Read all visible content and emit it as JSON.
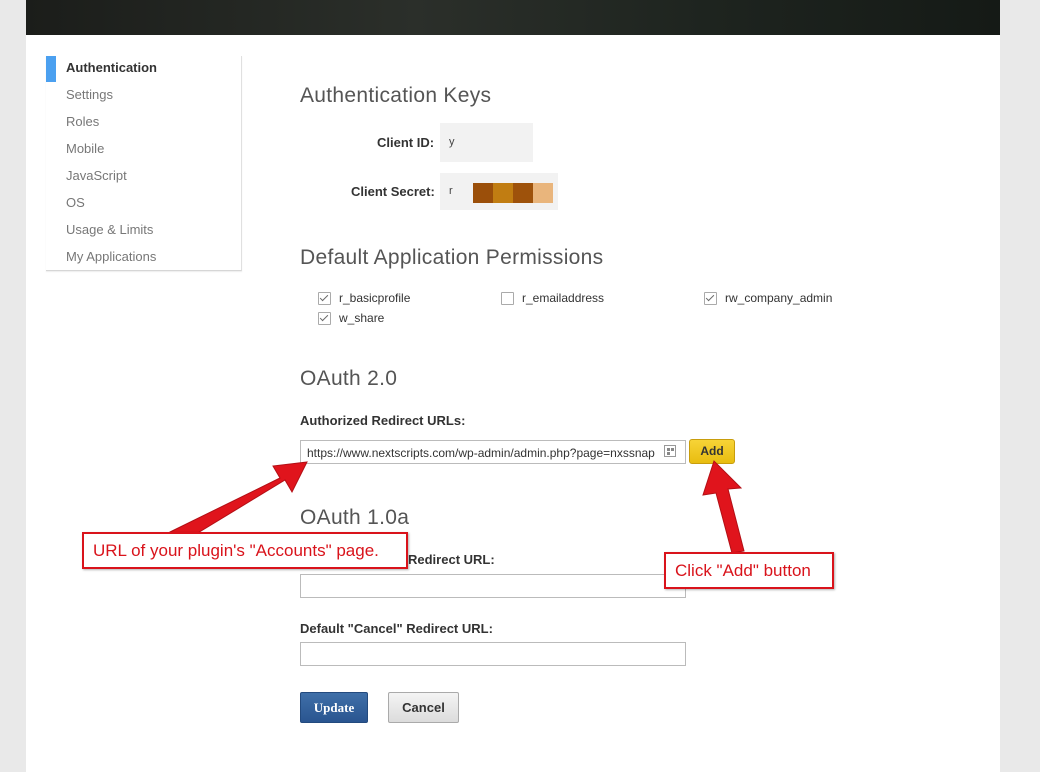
{
  "sidebar": {
    "items": [
      {
        "label": "Authentication",
        "active": true
      },
      {
        "label": "Settings"
      },
      {
        "label": "Roles"
      },
      {
        "label": "Mobile"
      },
      {
        "label": "JavaScript"
      },
      {
        "label": "OS"
      },
      {
        "label": "Usage & Limits"
      },
      {
        "label": "My Applications"
      }
    ]
  },
  "auth_keys": {
    "title": "Authentication Keys",
    "client_id_label": "Client ID:",
    "client_id_value": "y",
    "client_secret_label": "Client Secret:",
    "client_secret_value": "r"
  },
  "permissions": {
    "title": "Default Application Permissions",
    "items": [
      {
        "label": "r_basicprofile",
        "checked": true
      },
      {
        "label": "r_emailaddress",
        "checked": false
      },
      {
        "label": "rw_company_admin",
        "checked": true
      },
      {
        "label": "w_share",
        "checked": true
      }
    ]
  },
  "oauth2": {
    "title": "OAuth 2.0",
    "redirect_label": "Authorized Redirect URLs:",
    "redirect_value": "https://www.nextscripts.com/wp-admin/admin.php?page=nxssnap",
    "add_label": "Add"
  },
  "oauth1": {
    "title": "OAuth 1.0a",
    "accept_label": "Redirect URL:",
    "cancel_label": "Default \"Cancel\" Redirect URL:"
  },
  "buttons": {
    "update": "Update",
    "cancel": "Cancel"
  },
  "callouts": {
    "url_note": "URL of your plugin's \"Accounts\" page.",
    "add_note": "Click \"Add\" button"
  },
  "colors": {
    "accent": "#4ba0f0",
    "callout_red": "#d9131b",
    "add_button": "#f0c927",
    "update_button": "#2f5f9c"
  }
}
